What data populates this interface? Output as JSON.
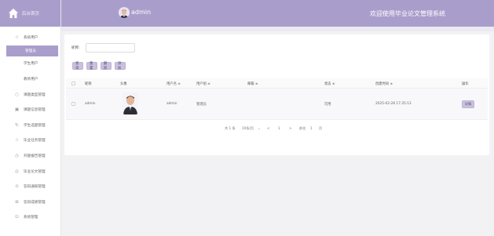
{
  "brand": {
    "label": "后台首页"
  },
  "sidebar": {
    "items": [
      {
        "label": "系统用户",
        "icon": "star-outline-icon"
      },
      {
        "label": "管理员",
        "active": true
      },
      {
        "label": "学生用户"
      },
      {
        "label": "教师用户"
      },
      {
        "label": "课题类型管理",
        "icon": "circle-icon"
      },
      {
        "label": "课题信息管理",
        "icon": "square-icon"
      },
      {
        "label": "学生选题管理",
        "icon": "refresh-icon"
      },
      {
        "label": "毕业任务管理",
        "icon": "star-outline-icon"
      },
      {
        "label": "开题报告管理",
        "icon": "clock-icon"
      },
      {
        "label": "毕业论文管理",
        "icon": "compass-icon"
      },
      {
        "label": "答辩通知管理",
        "icon": "circle-dot-icon"
      },
      {
        "label": "答辩成绩管理",
        "icon": "grid-icon"
      },
      {
        "label": "系统管理",
        "icon": "square-dot-icon"
      }
    ]
  },
  "header": {
    "user": "admin",
    "welcome": "欢迎使用毕业论文管理系统"
  },
  "search": {
    "label": "昵称:",
    "placeholder": ""
  },
  "toolbar": {
    "query": "查询",
    "reset": "重置",
    "delete": "删除",
    "add": "添加"
  },
  "table": {
    "headers": [
      "昵称",
      "头像",
      "用户名 ≑",
      "用户组 ≑",
      "邮箱 ≑",
      "状态 ≑",
      "创建时间 ≑",
      "操作"
    ],
    "rows": [
      {
        "nickname": "admin",
        "username": "admin",
        "group": "管理员",
        "email": "",
        "status": "可用",
        "created": "2025-02-28 17:35:13",
        "action": "详情"
      }
    ]
  },
  "pagination": {
    "total": "共 1 条",
    "page_size": "10条/页",
    "prev": "<",
    "current": "1",
    "next": ">",
    "goto_label": "前往",
    "goto_value": "1",
    "page_unit": "页"
  },
  "colors": {
    "accent": "#a99ecb",
    "button_bg": "#c9c1dd"
  }
}
